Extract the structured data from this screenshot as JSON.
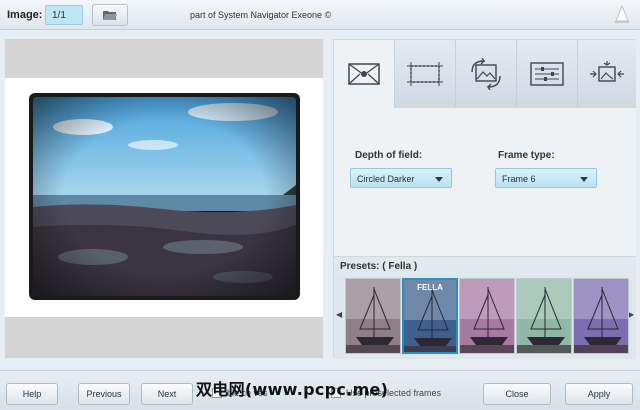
{
  "topbar": {
    "image_label": "Image:",
    "image_counter": "1/1",
    "open_icon": "folder-open-icon",
    "title": "part of System Navigator Exeone ©",
    "logo_icon": "sail-logo-icon"
  },
  "tools": [
    {
      "icon": "envelope-blur-icon",
      "active": true
    },
    {
      "icon": "crop-frame-icon",
      "active": false
    },
    {
      "icon": "rotate-image-icon",
      "active": false
    },
    {
      "icon": "sliders-icon",
      "active": false
    },
    {
      "icon": "resize-image-icon",
      "active": false
    }
  ],
  "settings": {
    "depth_label": "Depth of field:",
    "depth_value": "Circled Darker",
    "frame_label": "Frame type:",
    "frame_value": "Frame 6"
  },
  "presets": {
    "label": "Presets: ( Fella )",
    "items": [
      {
        "tint": "#8e7f86",
        "selected": false,
        "name": ""
      },
      {
        "tint": "#3f5f8c",
        "selected": true,
        "name": "FELLA"
      },
      {
        "tint": "#a77aa3",
        "selected": false,
        "name": ""
      },
      {
        "tint": "#8fb8a6",
        "selected": false,
        "name": ""
      },
      {
        "tint": "#7c6fb0",
        "selected": false,
        "name": ""
      }
    ]
  },
  "bottombar": {
    "help": "Help",
    "previous": "Previous",
    "next": "Next",
    "check1": "ble ce ves",
    "check2": "Use preselected frames",
    "close": "Close",
    "apply": "Apply"
  },
  "watermark": "双电网(www.pcpc.me)",
  "colors": {
    "accent": "#2b8fc2",
    "dropdown": "#bfe6f3"
  }
}
